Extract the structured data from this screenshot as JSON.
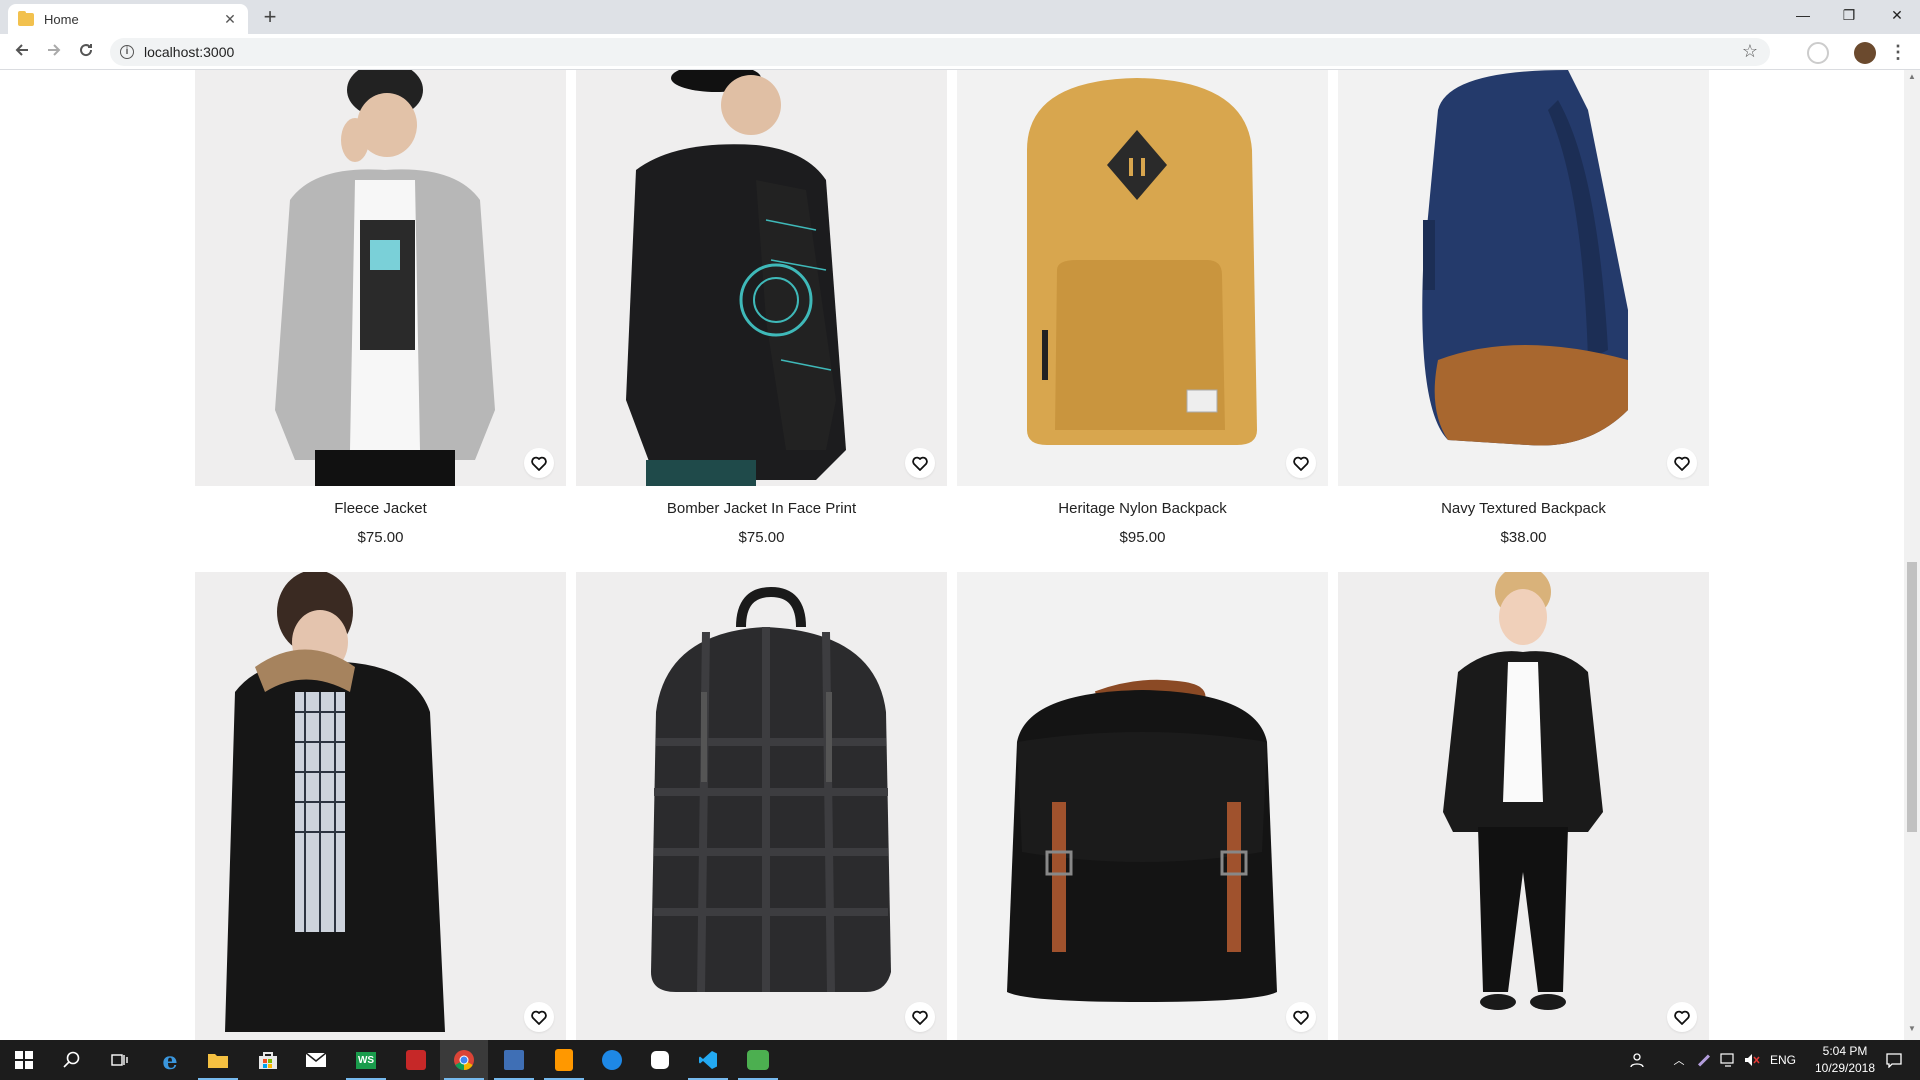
{
  "browser": {
    "tab_title": "Home",
    "tab_close": "✕",
    "new_tab": "+",
    "url": "localhost:3000",
    "window_controls": {
      "minimize": "—",
      "restore": "❐",
      "close": "✕"
    }
  },
  "products": [
    {
      "name": "Fleece Jacket",
      "price": "$75.00",
      "image": "grey-fleece-jacket"
    },
    {
      "name": "Bomber Jacket In Face Print",
      "price": "$75.00",
      "image": "black-bomber-jacket"
    },
    {
      "name": "Heritage Nylon Backpack",
      "price": "$95.00",
      "image": "gold-backpack"
    },
    {
      "name": "Navy Textured Backpack",
      "price": "$38.00",
      "image": "navy-backpack"
    },
    {
      "name": "",
      "price": "",
      "image": "black-parka"
    },
    {
      "name": "",
      "price": "",
      "image": "black-plaid-backpack"
    },
    {
      "name": "",
      "price": "",
      "image": "black-canvas-rucksack"
    },
    {
      "name": "",
      "price": "",
      "image": "leather-jacket-outfit"
    }
  ],
  "taskbar": {
    "apps": [
      "start-icon",
      "search-icon",
      "task-view-icon",
      "edge-icon",
      "file-explorer-icon",
      "store-icon",
      "mail-icon",
      "webstorm-icon",
      "app-icon",
      "chrome-icon",
      "network-app-icon",
      "sublime-icon",
      "app-store-icon",
      "slack-icon",
      "vscode-icon",
      "chat-icon"
    ],
    "language": "ENG",
    "time": "5:04 PM",
    "date": "10/29/2018"
  },
  "colors": {
    "card_bg": "#efeeee",
    "taskbar_bg": "#1c1c1c",
    "tabstrip_bg": "#dee1e6"
  }
}
